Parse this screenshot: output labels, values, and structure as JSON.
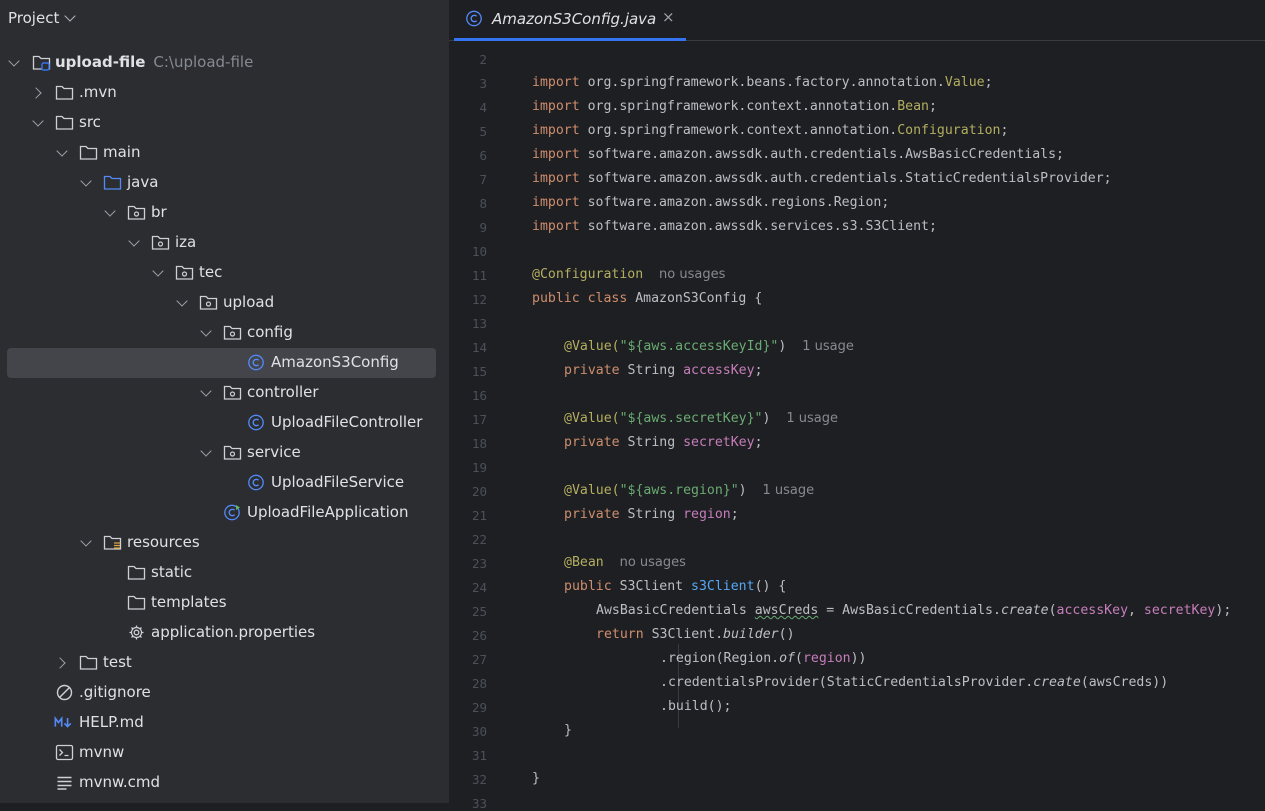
{
  "project_panel": {
    "title": "Project",
    "tree": [
      {
        "label": "upload-file",
        "hint": "C:\\upload-file"
      },
      {
        "label": ".mvn"
      },
      {
        "label": "src"
      },
      {
        "label": "main"
      },
      {
        "label": "java"
      },
      {
        "label": "br"
      },
      {
        "label": "iza"
      },
      {
        "label": "tec"
      },
      {
        "label": "upload"
      },
      {
        "label": "config"
      },
      {
        "label": "AmazonS3Config"
      },
      {
        "label": "controller"
      },
      {
        "label": "UploadFileController"
      },
      {
        "label": "service"
      },
      {
        "label": "UploadFileService"
      },
      {
        "label": "UploadFileApplication"
      },
      {
        "label": "resources"
      },
      {
        "label": "static"
      },
      {
        "label": "templates"
      },
      {
        "label": "application.properties"
      },
      {
        "label": "test"
      },
      {
        "label": ".gitignore"
      },
      {
        "label": "HELP.md"
      },
      {
        "label": "mvnw"
      },
      {
        "label": "mvnw.cmd"
      }
    ]
  },
  "editor": {
    "tab_label": "AmazonS3Config.java",
    "tab_close": "×",
    "line_numbers": [
      "2",
      "3",
      "4",
      "5",
      "6",
      "7",
      "8",
      "9",
      "10",
      "11",
      "12",
      "13",
      "14",
      "15",
      "16",
      "17",
      "18",
      "19",
      "20",
      "21",
      "22",
      "23",
      "24",
      "25",
      "26",
      "27",
      "28",
      "29",
      "30",
      "31",
      "32",
      "33"
    ],
    "code": {
      "l3": {
        "kw": "import",
        "pkg": " org.springframework.beans.factory.annotation.",
        "cls": "Value",
        "end": ";"
      },
      "l4": {
        "kw": "import",
        "pkg": " org.springframework.context.annotation.",
        "cls": "Bean",
        "end": ";"
      },
      "l5": {
        "kw": "import",
        "pkg": " org.springframework.context.annotation.",
        "cls": "Configuration",
        "end": ";"
      },
      "l6": {
        "kw": "import",
        "rest": " software.amazon.awssdk.auth.credentials.AwsBasicCredentials;"
      },
      "l7": {
        "kw": "import",
        "rest": " software.amazon.awssdk.auth.credentials.StaticCredentialsProvider;"
      },
      "l8": {
        "kw": "import",
        "rest": " software.amazon.awssdk.regions.Region;"
      },
      "l9": {
        "kw": "import",
        "rest": " software.amazon.awssdk.services.s3.S3Client;"
      },
      "l11": {
        "ann": "@Configuration",
        "hint": "no usages"
      },
      "l12": {
        "kw": "public class",
        "name": " AmazonS3Config",
        "rest": " {"
      },
      "l14": {
        "ann": "@Value(",
        "str": "\"${aws.accessKeyId}\"",
        "close": ")",
        "hint": "1 usage"
      },
      "l15": {
        "kw": "private",
        "type": " String",
        "fld": " accessKey",
        "end": ";"
      },
      "l17": {
        "ann": "@Value(",
        "str": "\"${aws.secretKey}\"",
        "close": ")",
        "hint": "1 usage"
      },
      "l18": {
        "kw": "private",
        "type": " String",
        "fld": " secretKey",
        "end": ";"
      },
      "l20": {
        "ann": "@Value(",
        "str": "\"${aws.region}\"",
        "close": ")",
        "hint": "1 usage"
      },
      "l21": {
        "kw": "private",
        "type": " String",
        "fld": " region",
        "end": ";"
      },
      "l23": {
        "ann": "@Bean",
        "hint": "no usages"
      },
      "l24": {
        "kw": "public",
        "type": " S3Client ",
        "name": "s3Client",
        "rest": "() {"
      },
      "l25": {
        "a": "AwsBasicCredentials ",
        "var": "awsCreds",
        "b": " = AwsBasicCredentials.",
        "m": "create",
        "c": "(",
        "f1": "accessKey",
        "d": ", ",
        "f2": "secretKey",
        "e": ");"
      },
      "l26": {
        "kw": "return",
        "a": " S3Client.",
        "m": "builder",
        "b": "()"
      },
      "l27": {
        "a": ".region(Region.",
        "m": "of",
        "b": "(",
        "f": "region",
        "c": "))"
      },
      "l28": {
        "a": ".credentialsProvider(StaticCredentialsProvider.",
        "m": "create",
        "b": "(awsCreds))"
      },
      "l29": {
        "a": ".build();"
      },
      "l30": {
        "a": "}"
      },
      "l32": {
        "a": "}"
      }
    }
  },
  "colors": {
    "panel_bg": "#2b2d30",
    "editor_bg": "#1e1f22",
    "accent": "#3574f0",
    "keyword": "#cf8e6d",
    "annotation": "#b3ae60",
    "string": "#6aab73",
    "field": "#c77dbb"
  }
}
